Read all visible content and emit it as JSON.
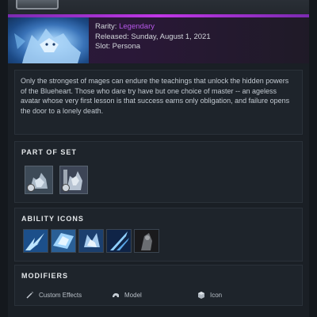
{
  "header": {
    "rarity_label": "Rarity:",
    "rarity_value": "Legendary",
    "released": "Released: Sunday, August 1, 2021",
    "slot": "Slot: Persona"
  },
  "description": "Only the strongest of mages can endure the teachings that unlock the hidden powers of the Blueheart. Those who dare try have but one choice of master -- an ageless avatar whose very first lesson is that success earns only obligation, and failure opens the door to a lonely death.",
  "part_of_set": {
    "title": "PART OF SET",
    "items": [
      {
        "icon": "hero-model-icon"
      },
      {
        "icon": "hero-model-icon"
      }
    ]
  },
  "ability_icons": {
    "title": "ABILITY ICONS",
    "items": [
      {
        "icon": "ice-shard-icon"
      },
      {
        "icon": "ice-shard-icon"
      },
      {
        "icon": "ice-crystal-icon"
      },
      {
        "icon": "ice-streak-icon"
      },
      {
        "icon": "dark-ability-icon"
      }
    ]
  },
  "modifiers": {
    "title": "MODIFIERS",
    "items": [
      {
        "label": "Custom Effects",
        "icon": "wand-icon"
      },
      {
        "label": "Model",
        "icon": "animal-icon"
      },
      {
        "label": "Icon",
        "icon": "cube-icon"
      }
    ]
  },
  "colors": {
    "accent": "#c037e6",
    "rarity": "#b657e8",
    "panel_bg": "#1e242b",
    "page_bg": "#14181d"
  }
}
